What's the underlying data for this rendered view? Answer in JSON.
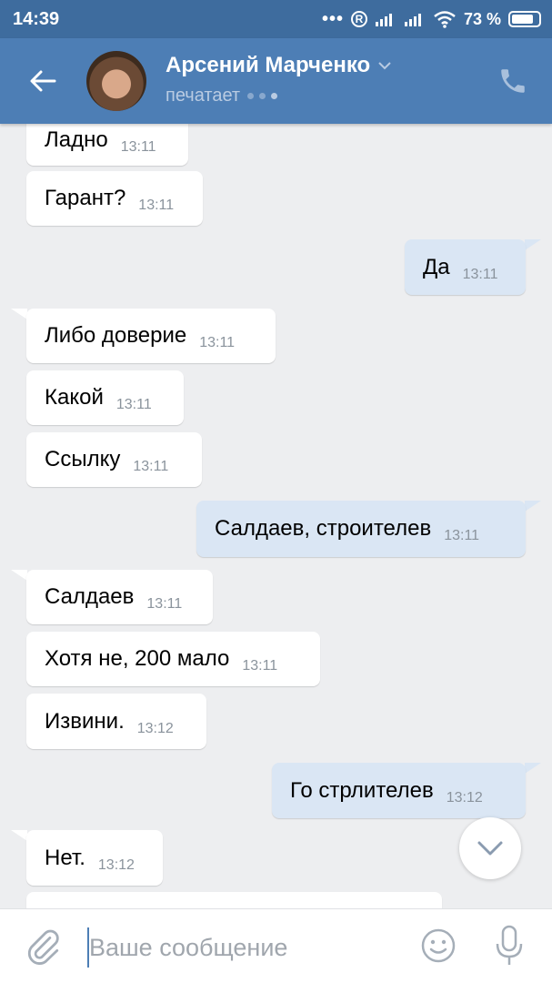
{
  "status_bar": {
    "time": "14:39",
    "dots": "•••",
    "r_icon": "R",
    "battery_percent": "73 %",
    "battery_level": 0.73
  },
  "header": {
    "contact_name": "Арсений Марченко",
    "status": "печатает",
    "icons": {
      "back": "back-arrow-icon",
      "call": "phone-icon",
      "dropdown": "chevron-down-icon"
    }
  },
  "messages": [
    {
      "text": "Ладно",
      "time": "13:11",
      "direction": "in"
    },
    {
      "text": "Гарант?",
      "time": "13:11",
      "direction": "in"
    },
    {
      "text": "Да",
      "time": "13:11",
      "direction": "out"
    },
    {
      "text": "Либо доверие",
      "time": "13:11",
      "direction": "in"
    },
    {
      "text": "Какой",
      "time": "13:11",
      "direction": "in"
    },
    {
      "text": "Ссылку",
      "time": "13:11",
      "direction": "in"
    },
    {
      "text": "Салдаев, строителев",
      "time": "13:11",
      "direction": "out"
    },
    {
      "text": "Салдаев",
      "time": "13:11",
      "direction": "in"
    },
    {
      "text": "Хотя не, 200 мало",
      "time": "13:11",
      "direction": "in"
    },
    {
      "text": "Извини.",
      "time": "13:12",
      "direction": "in"
    },
    {
      "text": "Го стрлителев",
      "time": "13:12",
      "direction": "out"
    },
    {
      "text": "Нет.",
      "time": "13:12",
      "direction": "in"
    }
  ],
  "composer": {
    "placeholder": "Ваше сообщение",
    "icons": {
      "attach": "paperclip-icon",
      "emoji": "smiley-icon",
      "mic": "microphone-icon",
      "scroll": "chevron-down-icon"
    }
  }
}
